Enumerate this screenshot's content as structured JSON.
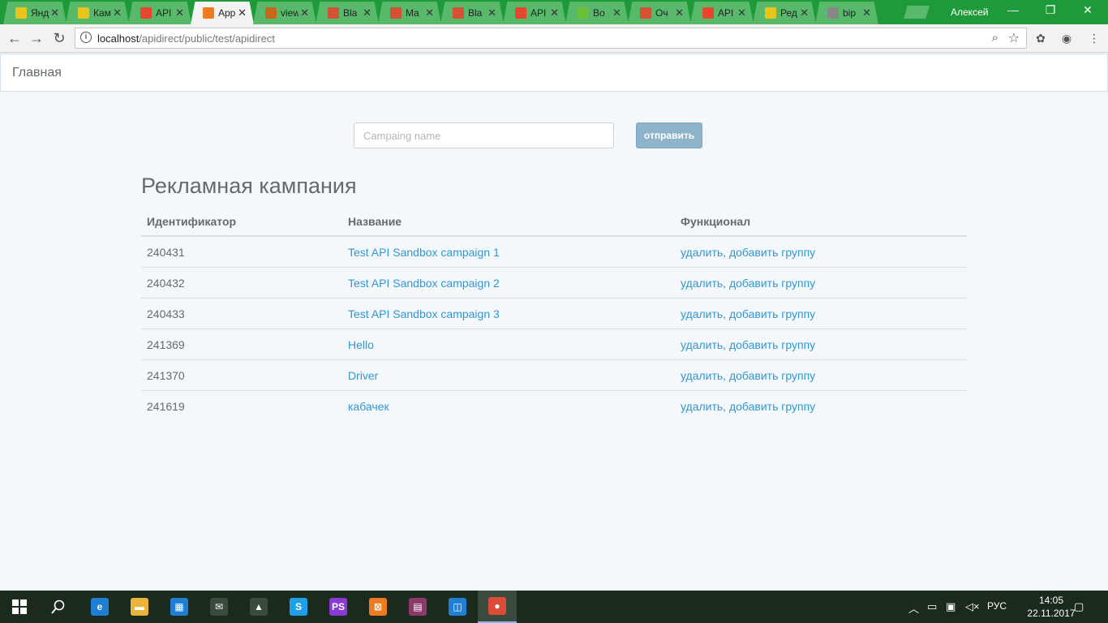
{
  "browser": {
    "tabs": [
      {
        "title": "Янд",
        "favicon": "yellow-doc-icon",
        "color": "#e8c51a"
      },
      {
        "title": "Кам",
        "favicon": "yellow-doc-icon",
        "color": "#e8c51a"
      },
      {
        "title": "API",
        "favicon": "yandex-icon",
        "color": "#e8462f"
      },
      {
        "title": "App",
        "favicon": "xampp-icon",
        "color": "#f07a20",
        "active": true
      },
      {
        "title": "view",
        "favicon": "xampp-icon",
        "color": "#c46a1a"
      },
      {
        "title": "Bla",
        "favicon": "laravel-icon",
        "color": "#d15333"
      },
      {
        "title": "Ma",
        "favicon": "laravel-icon",
        "color": "#d15333"
      },
      {
        "title": "Bla",
        "favicon": "laravel-icon",
        "color": "#d15333"
      },
      {
        "title": "API",
        "favicon": "yandex-icon",
        "color": "#e8462f"
      },
      {
        "title": "Bo",
        "favicon": "green-icon",
        "color": "#6bbf3a"
      },
      {
        "title": "Оч",
        "favicon": "laravel-icon",
        "color": "#d15333"
      },
      {
        "title": "API",
        "favicon": "yandex-icon",
        "color": "#e8462f"
      },
      {
        "title": "Ред",
        "favicon": "yellow-doc-icon",
        "color": "#e8c51a"
      },
      {
        "title": "bip",
        "favicon": "smile-icon",
        "color": "#888888"
      }
    ],
    "user_name": "Алексей",
    "url_host": "localhost",
    "url_path": "/apidirect/public/test/apidirect"
  },
  "page": {
    "brand": "Главная",
    "form": {
      "placeholder": "Campaing name",
      "submit_label": "отправить"
    },
    "heading": "Рекламная кампания",
    "table": {
      "columns": [
        "Идентификатор",
        "Название",
        "Функционал"
      ],
      "rows": [
        {
          "id": "240431",
          "name": "Test API Sandbox campaign 1",
          "actions": "удалить, добавить группу"
        },
        {
          "id": "240432",
          "name": "Test API Sandbox campaign 2",
          "actions": "удалить, добавить группу"
        },
        {
          "id": "240433",
          "name": "Test API Sandbox campaign 3",
          "actions": "удалить, добавить группу"
        },
        {
          "id": "241369",
          "name": "Hello",
          "actions": "удалить, добавить группу"
        },
        {
          "id": "241370",
          "name": "Driver",
          "actions": "удалить, добавить группу"
        },
        {
          "id": "241619",
          "name": "кабачек",
          "actions": "удалить, добавить группу"
        }
      ]
    }
  },
  "taskbar": {
    "language": "РУС",
    "time": "14:05",
    "date": "22.11.2017",
    "apps": [
      {
        "name": "edge-icon",
        "glyph": "e",
        "color": "#1e7fd4"
      },
      {
        "name": "file-explorer-icon",
        "glyph": "▬",
        "color": "#e8b53a"
      },
      {
        "name": "store-icon",
        "glyph": "▦",
        "color": "#1e7fd4"
      },
      {
        "name": "mail-icon",
        "glyph": "✉",
        "color": "#3a4a3c"
      },
      {
        "name": "photos-icon",
        "glyph": "▲",
        "color": "#3a4a3c"
      },
      {
        "name": "skype-icon",
        "glyph": "S",
        "color": "#1ea0e8"
      },
      {
        "name": "phpstorm-icon",
        "glyph": "PS",
        "color": "#8a3ad4"
      },
      {
        "name": "xampp-icon",
        "glyph": "⊠",
        "color": "#f07a20"
      },
      {
        "name": "winrar-icon",
        "glyph": "▤",
        "color": "#8a3a6a"
      },
      {
        "name": "app-icon",
        "glyph": "◫",
        "color": "#1e7fd4"
      },
      {
        "name": "chrome-icon",
        "glyph": "●",
        "color": "#dd4b39",
        "active": true
      }
    ]
  }
}
